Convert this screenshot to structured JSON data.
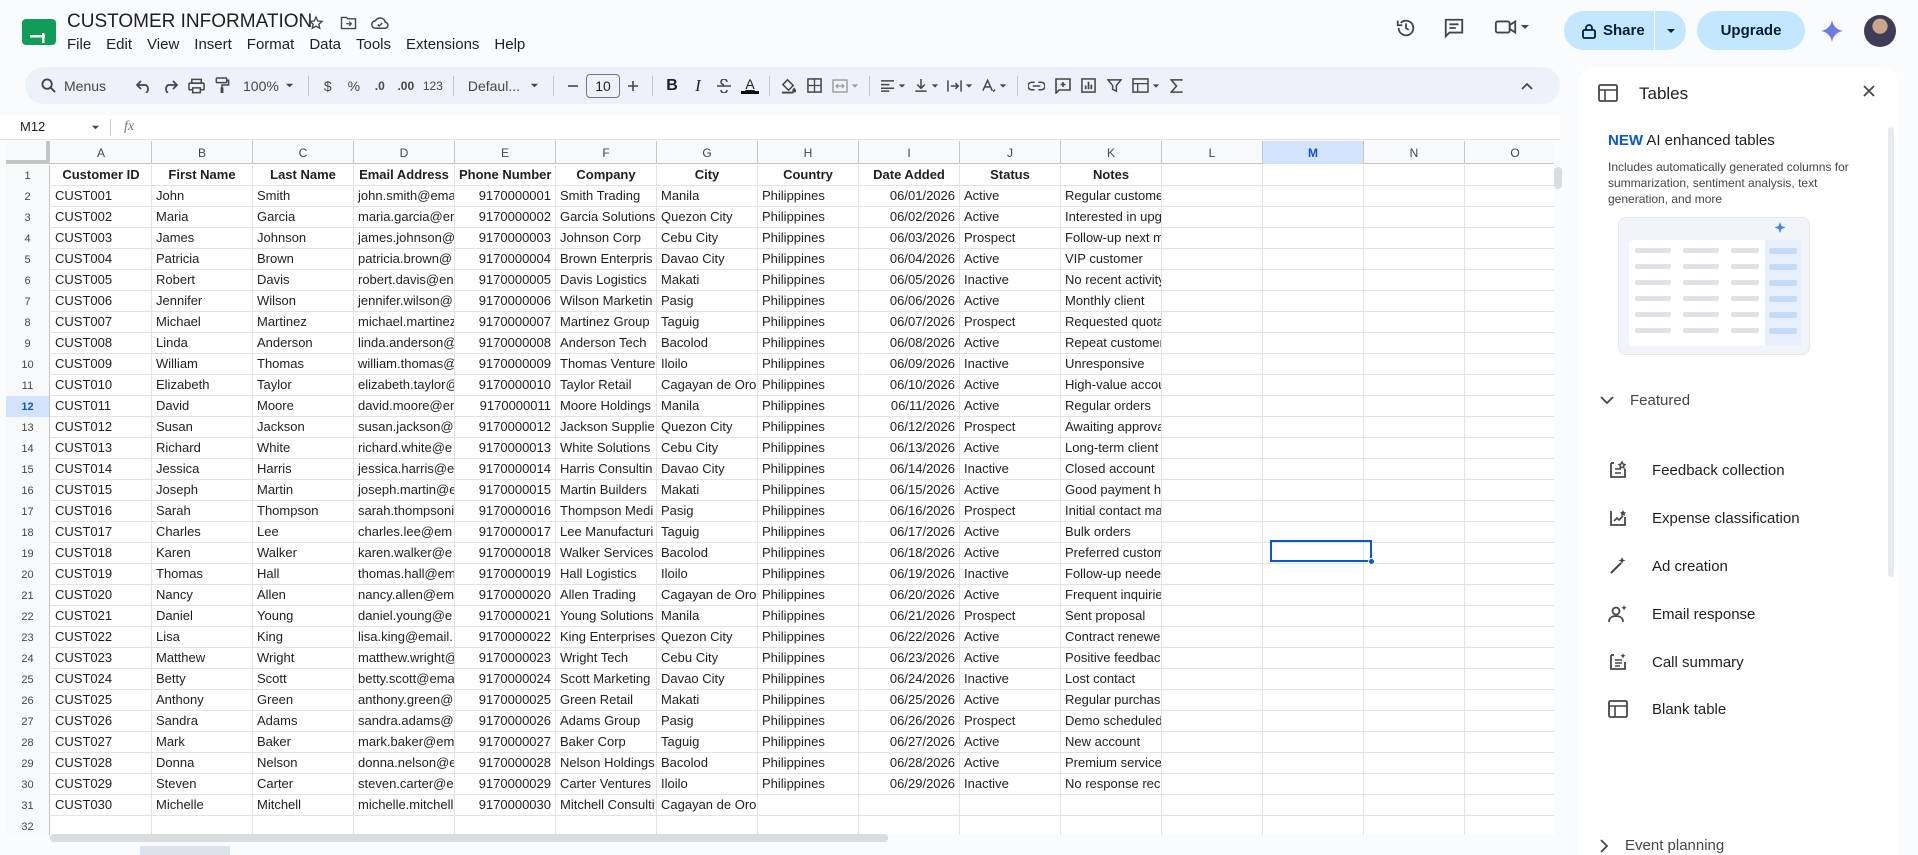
{
  "doc": {
    "title": "CUSTOMER INFORMATION",
    "menus": [
      "File",
      "Edit",
      "View",
      "Insert",
      "Format",
      "Data",
      "Tools",
      "Extensions",
      "Help"
    ]
  },
  "header": {
    "share_label": "Share",
    "upgrade_label": "Upgrade"
  },
  "toolbar": {
    "menus_label": "Menus",
    "zoom": "100%",
    "currency": "$",
    "percent": "%",
    "dec_minus": ".0",
    "dec_plus": ".00",
    "number_format": "123",
    "font": "Defaul...",
    "font_size": "10",
    "bold": "B",
    "italic": "I",
    "underline_a": "A"
  },
  "formula": {
    "cell_ref": "M12",
    "fx": "fx"
  },
  "columns": [
    "A",
    "B",
    "C",
    "D",
    "E",
    "F",
    "G",
    "H",
    "I",
    "J",
    "K",
    "L",
    "M",
    "N",
    "O"
  ],
  "table": {
    "headers": [
      "Customer ID",
      "First Name",
      "Last Name",
      "Email Address",
      "Phone Number",
      "Company",
      "City",
      "Country",
      "Date Added",
      "Status",
      "Notes"
    ],
    "rows": [
      [
        "CUST001",
        "John",
        "Smith",
        "john.smith@ema",
        "9170000001",
        "Smith Trading",
        "Manila",
        "Philippines",
        "06/01/2026",
        "Active",
        "Regular customer"
      ],
      [
        "CUST002",
        "Maria",
        "Garcia",
        "maria.garcia@en",
        "9170000002",
        "Garcia Solutions",
        "Quezon City",
        "Philippines",
        "06/02/2026",
        "Active",
        "Interested in upgrades"
      ],
      [
        "CUST003",
        "James",
        "Johnson",
        "james.johnson@",
        "9170000003",
        "Johnson Corp",
        "Cebu City",
        "Philippines",
        "06/03/2026",
        "Prospect",
        "Follow-up next month"
      ],
      [
        "CUST004",
        "Patricia",
        "Brown",
        "patricia.brown@",
        "9170000004",
        "Brown Enterpris",
        "Davao City",
        "Philippines",
        "06/04/2026",
        "Active",
        "VIP customer"
      ],
      [
        "CUST005",
        "Robert",
        "Davis",
        "robert.davis@en",
        "9170000005",
        "Davis Logistics",
        "Makati",
        "Philippines",
        "06/05/2026",
        "Inactive",
        "No recent activity"
      ],
      [
        "CUST006",
        "Jennifer",
        "Wilson",
        "jennifer.wilson@",
        "9170000006",
        "Wilson Marketin",
        "Pasig",
        "Philippines",
        "06/06/2026",
        "Active",
        "Monthly client"
      ],
      [
        "CUST007",
        "Michael",
        "Martinez",
        "michael.martinez",
        "9170000007",
        "Martinez Group",
        "Taguig",
        "Philippines",
        "06/07/2026",
        "Prospect",
        "Requested quotation"
      ],
      [
        "CUST008",
        "Linda",
        "Anderson",
        "linda.anderson@",
        "9170000008",
        "Anderson Tech",
        "Bacolod",
        "Philippines",
        "06/08/2026",
        "Active",
        "Repeat customer"
      ],
      [
        "CUST009",
        "William",
        "Thomas",
        "william.thomas@",
        "9170000009",
        "Thomas Venture",
        "Iloilo",
        "Philippines",
        "06/09/2026",
        "Inactive",
        "Unresponsive"
      ],
      [
        "CUST010",
        "Elizabeth",
        "Taylor",
        "elizabeth.taylor@",
        "9170000010",
        "Taylor Retail",
        "Cagayan de Oro",
        "Philippines",
        "06/10/2026",
        "Active",
        "High-value account"
      ],
      [
        "CUST011",
        "David",
        "Moore",
        "david.moore@en",
        "9170000011",
        "Moore Holdings",
        "Manila",
        "Philippines",
        "06/11/2026",
        "Active",
        "Regular orders"
      ],
      [
        "CUST012",
        "Susan",
        "Jackson",
        "susan.jackson@",
        "9170000012",
        "Jackson Supplie",
        "Quezon City",
        "Philippines",
        "06/12/2026",
        "Prospect",
        "Awaiting approval"
      ],
      [
        "CUST013",
        "Richard",
        "White",
        "richard.white@e",
        "9170000013",
        "White Solutions",
        "Cebu City",
        "Philippines",
        "06/13/2026",
        "Active",
        "Long-term client"
      ],
      [
        "CUST014",
        "Jessica",
        "Harris",
        "jessica.harris@e",
        "9170000014",
        "Harris Consultin",
        "Davao City",
        "Philippines",
        "06/14/2026",
        "Inactive",
        "Closed account"
      ],
      [
        "CUST015",
        "Joseph",
        "Martin",
        "joseph.martin@e",
        "9170000015",
        "Martin Builders",
        "Makati",
        "Philippines",
        "06/15/2026",
        "Active",
        "Good payment history"
      ],
      [
        "CUST016",
        "Sarah",
        "Thompson",
        "sarah.thompsoni",
        "9170000016",
        "Thompson Medi",
        "Pasig",
        "Philippines",
        "06/16/2026",
        "Prospect",
        "Initial contact made"
      ],
      [
        "CUST017",
        "Charles",
        "Lee",
        "charles.lee@em",
        "9170000017",
        "Lee Manufacturi",
        "Taguig",
        "Philippines",
        "06/17/2026",
        "Active",
        "Bulk orders"
      ],
      [
        "CUST018",
        "Karen",
        "Walker",
        "karen.walker@e",
        "9170000018",
        "Walker Services",
        "Bacolod",
        "Philippines",
        "06/18/2026",
        "Active",
        "Preferred customer"
      ],
      [
        "CUST019",
        "Thomas",
        "Hall",
        "thomas.hall@em",
        "9170000019",
        "Hall Logistics",
        "Iloilo",
        "Philippines",
        "06/19/2026",
        "Inactive",
        "Follow-up needed"
      ],
      [
        "CUST020",
        "Nancy",
        "Allen",
        "nancy.allen@em",
        "9170000020",
        "Allen Trading",
        "Cagayan de Oro",
        "Philippines",
        "06/20/2026",
        "Active",
        "Frequent inquiries"
      ],
      [
        "CUST021",
        "Daniel",
        "Young",
        "daniel.young@e",
        "9170000021",
        "Young Solutions",
        "Manila",
        "Philippines",
        "06/21/2026",
        "Prospect",
        "Sent proposal"
      ],
      [
        "CUST022",
        "Lisa",
        "King",
        "lisa.king@email.",
        "9170000022",
        "King Enterprises",
        "Quezon City",
        "Philippines",
        "06/22/2026",
        "Active",
        "Contract renewed"
      ],
      [
        "CUST023",
        "Matthew",
        "Wright",
        "matthew.wright@",
        "9170000023",
        "Wright Tech",
        "Cebu City",
        "Philippines",
        "06/23/2026",
        "Active",
        "Positive feedback"
      ],
      [
        "CUST024",
        "Betty",
        "Scott",
        "betty.scott@ema",
        "9170000024",
        "Scott Marketing",
        "Davao City",
        "Philippines",
        "06/24/2026",
        "Inactive",
        "Lost contact"
      ],
      [
        "CUST025",
        "Anthony",
        "Green",
        "anthony.green@",
        "9170000025",
        "Green Retail",
        "Makati",
        "Philippines",
        "06/25/2026",
        "Active",
        "Regular purchaser"
      ],
      [
        "CUST026",
        "Sandra",
        "Adams",
        "sandra.adams@",
        "9170000026",
        "Adams Group",
        "Pasig",
        "Philippines",
        "06/26/2026",
        "Prospect",
        "Demo scheduled"
      ],
      [
        "CUST027",
        "Mark",
        "Baker",
        "mark.baker@em",
        "9170000027",
        "Baker Corp",
        "Taguig",
        "Philippines",
        "06/27/2026",
        "Active",
        "New account"
      ],
      [
        "CUST028",
        "Donna",
        "Nelson",
        "donna.nelson@e",
        "9170000028",
        "Nelson Holdings",
        "Bacolod",
        "Philippines",
        "06/28/2026",
        "Active",
        "Premium service plan"
      ],
      [
        "CUST029",
        "Steven",
        "Carter",
        "steven.carter@e",
        "9170000029",
        "Carter Ventures",
        "Iloilo",
        "Philippines",
        "06/29/2026",
        "Inactive",
        "No response received"
      ],
      [
        "CUST030",
        "Michelle",
        "Mitchell",
        "michelle.mitchell",
        "9170000030",
        "Mitchell Consulti",
        "Cagayan de Oro",
        "",
        "",
        "",
        ""
      ],
      [
        "",
        "",
        "",
        "",
        "",
        "",
        "",
        "",
        "",
        "",
        ""
      ]
    ]
  },
  "selected": {
    "column": "M",
    "row": "12"
  },
  "panel": {
    "title": "Tables",
    "new_badge": "NEW",
    "headline": "AI enhanced tables",
    "description": "Includes automatically generated columns for summarization, sentiment analysis, text generation, and more",
    "featured_label": "Featured",
    "items": [
      "Feedback collection",
      "Expense classification",
      "Ad creation",
      "Email response",
      "Call summary",
      "Blank table"
    ],
    "event_label": "Event planning"
  },
  "colors": {
    "accent": "#0b57d0",
    "share_bg": "#c2e7ff",
    "sheets_green": "#0f9d58"
  }
}
